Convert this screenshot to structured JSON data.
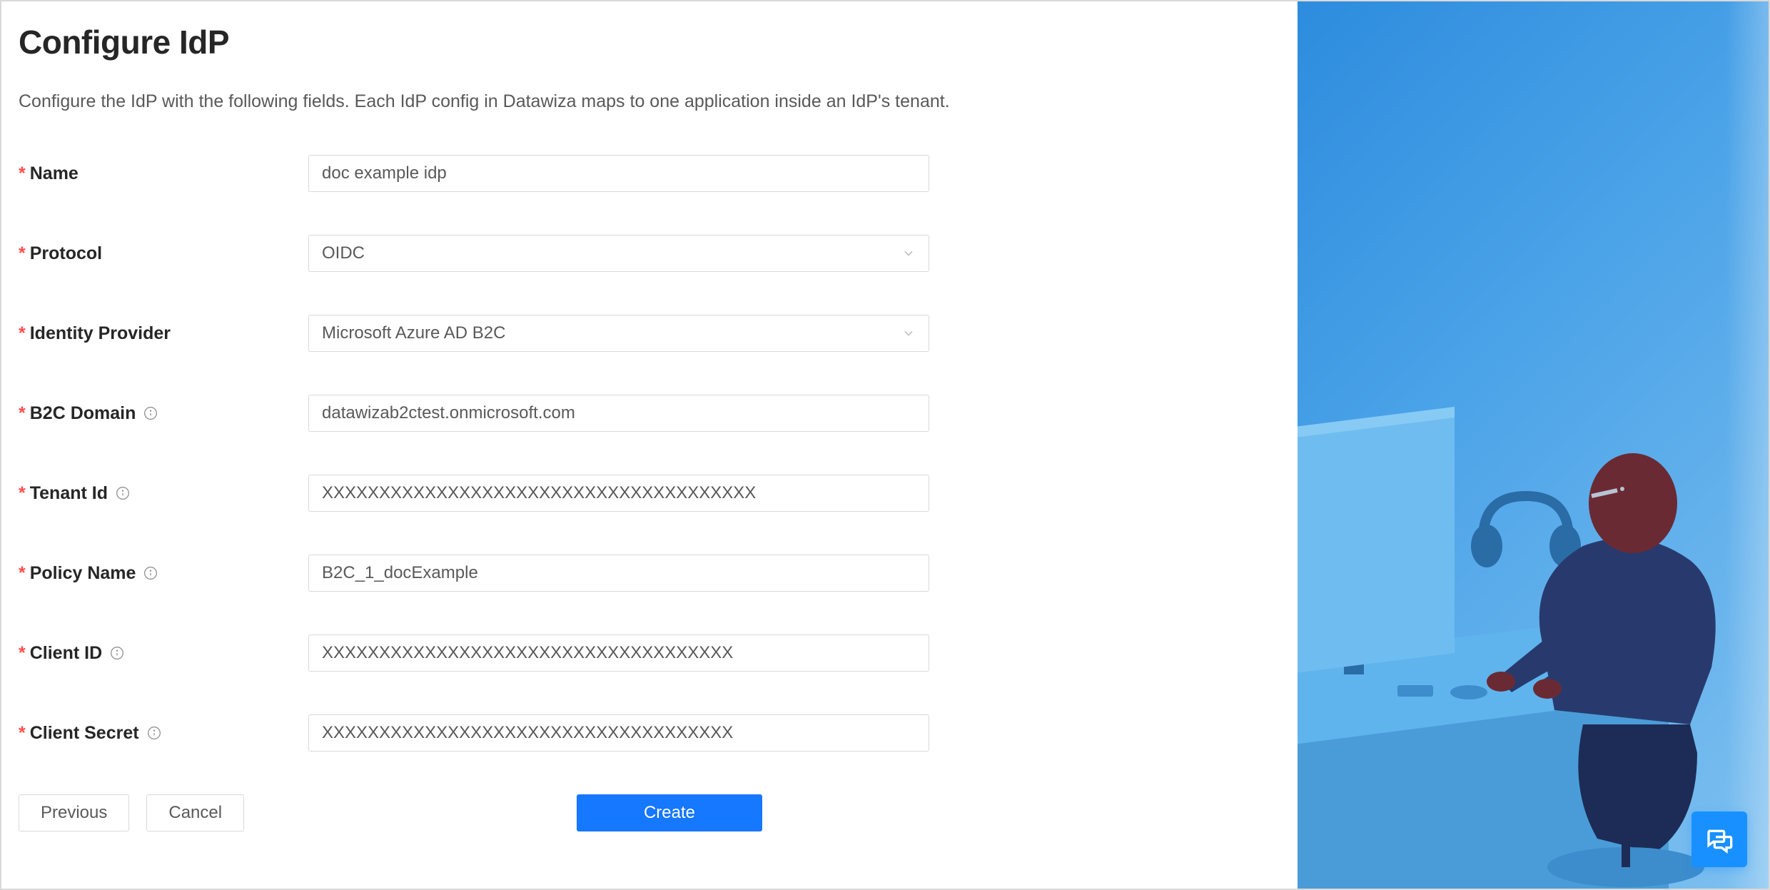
{
  "page": {
    "title": "Configure IdP",
    "subtitle": "Configure the IdP with the following fields. Each IdP config in Datawiza maps to one application inside an IdP's tenant."
  },
  "form": {
    "name": {
      "label": "Name",
      "value": "doc example idp"
    },
    "protocol": {
      "label": "Protocol",
      "value": "OIDC"
    },
    "identity_provider": {
      "label": "Identity Provider",
      "value": "Microsoft Azure AD B2C"
    },
    "b2c_domain": {
      "label": "B2C Domain",
      "value": "datawizab2ctest.onmicrosoft.com"
    },
    "tenant_id": {
      "label": "Tenant Id",
      "value": "XXXXXXXXXXXXXXXXXXXXXXXXXXXXXXXXXXXXXX"
    },
    "policy_name": {
      "label": "Policy Name",
      "value": "B2C_1_docExample"
    },
    "client_id": {
      "label": "Client ID",
      "value": "XXXXXXXXXXXXXXXXXXXXXXXXXXXXXXXXXXXX"
    },
    "client_secret": {
      "label": "Client Secret",
      "value": "XXXXXXXXXXXXXXXXXXXXXXXXXXXXXXXXXXXX"
    }
  },
  "buttons": {
    "previous": "Previous",
    "cancel": "Cancel",
    "create": "Create"
  }
}
